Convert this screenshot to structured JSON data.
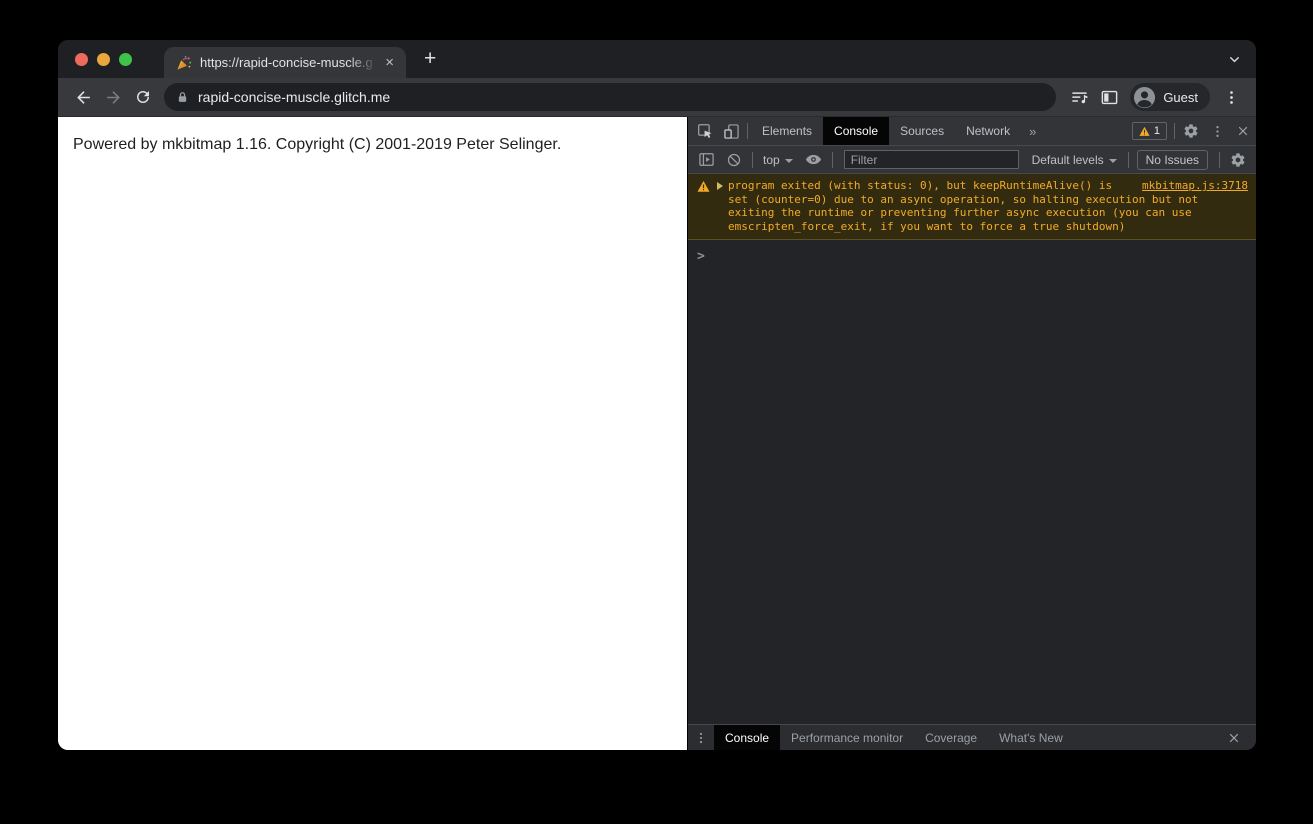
{
  "browser": {
    "tab_title": "https://rapid-concise-muscle.g",
    "url": "rapid-concise-muscle.glitch.me",
    "profile_label": "Guest"
  },
  "page": {
    "text": "Powered by mkbitmap 1.16. Copyright (C) 2001-2019 Peter Selinger."
  },
  "devtools": {
    "tabs": [
      "Elements",
      "Console",
      "Sources",
      "Network"
    ],
    "active_tab": "Console",
    "warning_count": "1",
    "toolbar": {
      "context_label": "top",
      "filter_placeholder": "Filter",
      "levels_label": "Default levels",
      "issues_label": "No Issues"
    },
    "console": {
      "warning_message": "program exited (with status: 0), but keepRuntimeAlive() is set (counter=0) due to an async operation, so halting execution but not exiting the runtime or preventing further async execution (you can use emscripten_force_exit, if you want to force a true shutdown)",
      "warning_source": "mkbitmap.js:3718",
      "prompt": ">"
    },
    "drawer_tabs": [
      "Console",
      "Performance monitor",
      "Coverage",
      "What's New"
    ],
    "drawer_active": "Console"
  },
  "icons": {
    "favicon": "party-popper-icon",
    "tab_close": "×",
    "new_tab": "+",
    "more_tabs": "»",
    "close": "×"
  },
  "colors": {
    "warning_text": "#f2ab26",
    "warning_bg": "#332b10",
    "chrome_dark": "#1f2023",
    "toolbar": "#38393d",
    "devtools_toolbar": "#333438",
    "active_tab": "#050505"
  }
}
